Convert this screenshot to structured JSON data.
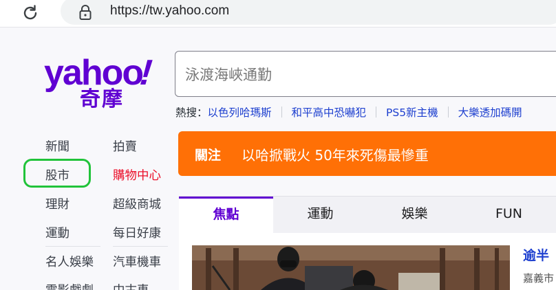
{
  "browser": {
    "url": "https://tw.yahoo.com"
  },
  "logo": {
    "word": "yahoo",
    "bang": "!",
    "sub": "奇摩"
  },
  "search": {
    "placeholder": "泳渡海峽通勤"
  },
  "hot_searches": {
    "label": "熱搜：",
    "items": [
      "以色列哈瑪斯",
      "和平高中恐嚇犯",
      "PS5新主機",
      "大樂透加碼開"
    ]
  },
  "nav": {
    "left": [
      "新聞",
      "股市",
      "理財",
      "運動",
      "名人娛樂",
      "電影戲劇"
    ],
    "right": [
      "拍賣",
      "購物中心",
      "超級商城",
      "每日好康",
      "汽車機車",
      "中古車"
    ]
  },
  "banner": {
    "tag": "關注",
    "text": "以哈掀戰火 50年來死傷最慘重"
  },
  "tabs": [
    "焦點",
    "運動",
    "娛樂",
    "FUN"
  ],
  "story": {
    "title": "逾半",
    "source": "嘉義市"
  },
  "colors": {
    "brand": "#6001d2",
    "banner": "#ff7006",
    "highlight": "#21c33a",
    "link": "#1d3fcf"
  }
}
